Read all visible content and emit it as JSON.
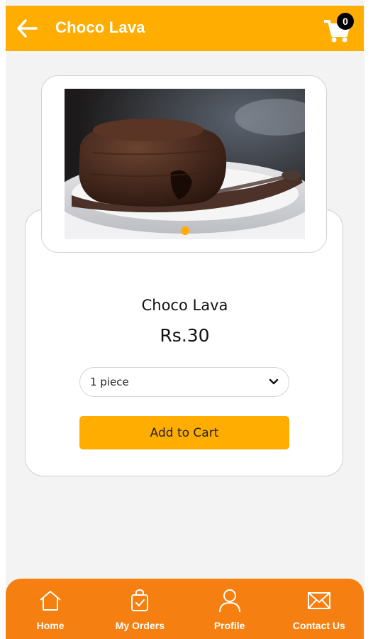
{
  "header": {
    "title": "Choco Lava",
    "back_icon": "arrow-left-icon",
    "cart_icon": "shopping-cart-icon",
    "cart_count": "0",
    "color": "#ffad00"
  },
  "product": {
    "name": "Choco Lava",
    "price": "Rs.30",
    "image_alt": "Choco lava cake on a plate with spoon",
    "carousel": {
      "slides_count": 1,
      "active_index": 0
    }
  },
  "quantity_select": {
    "selected": "1 piece",
    "icon": "chevron-down-icon"
  },
  "actions": {
    "add_to_cart_label": "Add to Cart",
    "accent": "#ffad00"
  },
  "bottom_nav": {
    "color": "#f57f10",
    "items": [
      {
        "label": "Home",
        "icon": "home-icon"
      },
      {
        "label": "My Orders",
        "icon": "shopping-bag-icon"
      },
      {
        "label": "Profile",
        "icon": "user-icon"
      },
      {
        "label": "Contact Us",
        "icon": "mail-icon"
      }
    ]
  }
}
